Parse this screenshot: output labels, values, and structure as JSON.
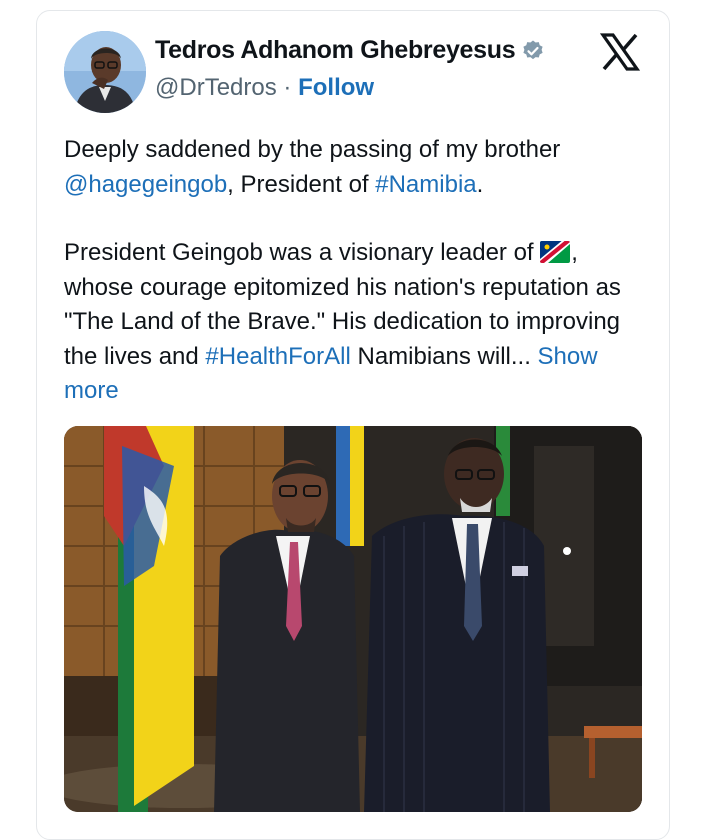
{
  "tweet": {
    "author": {
      "name": "Tedros Adhanom Ghebreyesus",
      "handle": "@DrTedros",
      "separator": "·",
      "follow_label": "Follow",
      "verified": true,
      "avatar_icon": "profile-photo"
    },
    "platform_logo": "x-logo-icon",
    "paragraph1": {
      "text1": "Deeply saddened by the passing of my brother ",
      "mention": "@hagegeingob",
      "text2": ", President of ",
      "hashtag": "#Namibia",
      "text3": "."
    },
    "paragraph2": {
      "text1": "President Geingob was a visionary leader of ",
      "flag_icon": "namibia-flag-emoji",
      "text2": ", whose courage epitomized his nation's reputation as \"The Land of the Brave.\" His dedication to improving the lives and ",
      "hashtag": "#HealthForAll",
      "text3": " Namibians will... ",
      "show_more": "Show more"
    },
    "photo": {
      "subject": "Two men in suits standing in front of Namibian flags"
    }
  },
  "colors": {
    "link": "#1d6fb8",
    "secondary_text": "#536471",
    "primary_text": "#0f1419",
    "border": "#e4e7ea",
    "verified_badge": "#829aab"
  }
}
